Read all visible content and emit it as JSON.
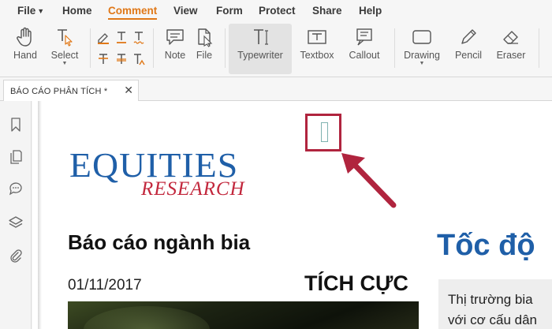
{
  "menu": {
    "file": "File",
    "home": "Home",
    "comment": "Comment",
    "view": "View",
    "form": "Form",
    "protect": "Protect",
    "share": "Share",
    "help": "Help"
  },
  "ribbon": {
    "hand": "Hand",
    "select": "Select",
    "note": "Note",
    "file": "File",
    "typewriter": "Typewriter",
    "textbox": "Textbox",
    "callout": "Callout",
    "drawing": "Drawing",
    "pencil": "Pencil",
    "eraser": "Eraser"
  },
  "tab": {
    "label": "BÁO CÁO PHÂN TÍCH *",
    "close": "✕"
  },
  "document": {
    "logo_main": "EQUITIES",
    "logo_sub": "RESEARCH",
    "title": "Báo cáo ngành bia",
    "date": "01/11/2017",
    "rating": "TÍCH CỰC",
    "right_title": "Tốc độ",
    "right_box_line1": "Thị trường bia",
    "right_box_line2": "với cơ cấu dân"
  },
  "colors": {
    "accent": "#e07818",
    "logo_blue": "#1f5fa8",
    "logo_red": "#c2273c",
    "annotation": "#b0243e"
  }
}
